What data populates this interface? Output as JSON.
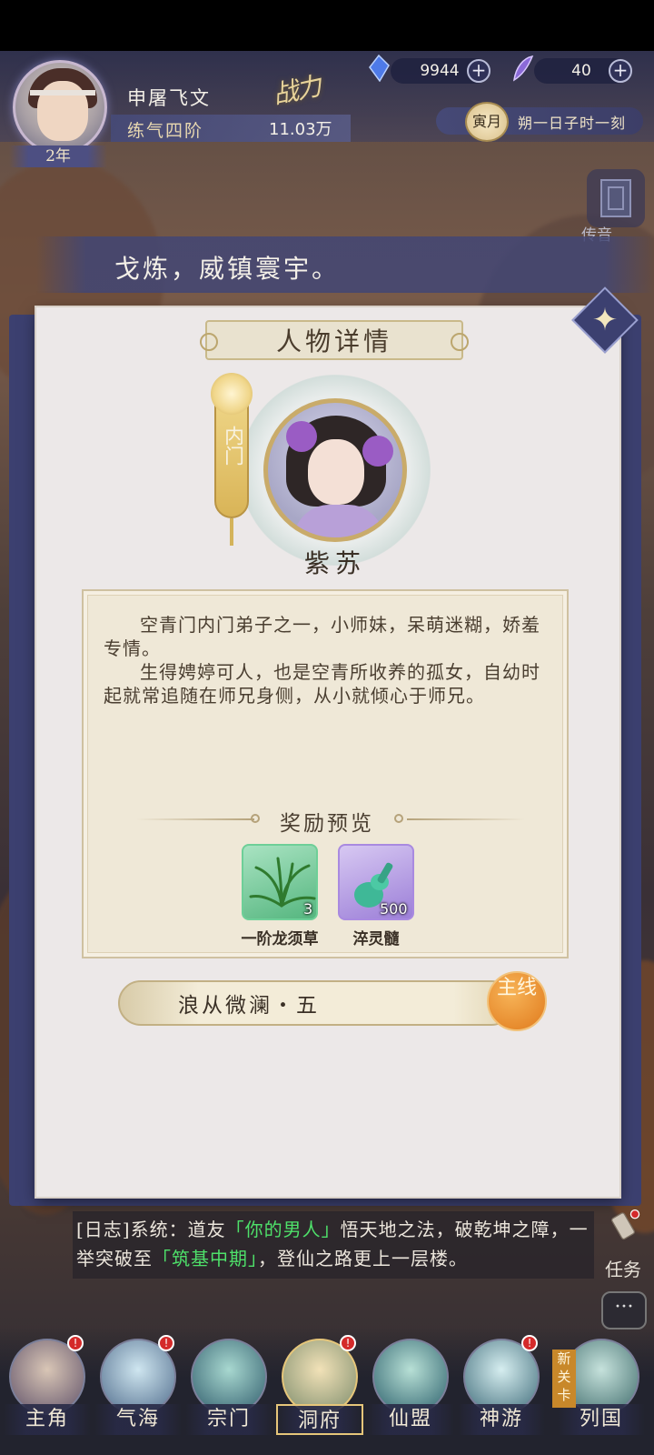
{
  "hud": {
    "player_name": "申屠飞文",
    "realm": "练气四阶",
    "age": "2年",
    "power_label": "战力",
    "power_value": "11.03万",
    "currency_crystal": "9944",
    "currency_feather": "40",
    "month": "寅月",
    "time": "朔一日子时一刻"
  },
  "side": {
    "transmit_label": "传音"
  },
  "marquee": {
    "text": "戈炼，威镇寰宇。"
  },
  "dialog": {
    "title": "人物详情",
    "sect": "内门",
    "character_name": "紫苏",
    "description": [
      "空青门内门弟子之一，小师妹，呆萌迷糊，娇羞专情。",
      "生得娉婷可人，也是空青所收养的孤女，自幼时起就常追随在师兄身侧，从小就倾心于师兄。"
    ],
    "reward_title": "奖励预览",
    "rewards": [
      {
        "name": "一阶龙须草",
        "count": "3",
        "icon": "herb-icon",
        "rarity_color": "#6ecf98"
      },
      {
        "name": "淬灵髓",
        "count": "500",
        "icon": "jade-gourd-icon",
        "rarity_color": "#a98ae0"
      }
    ],
    "quest_name": "浪从微澜・五",
    "quest_tag": "主线"
  },
  "log": {
    "prefix": "[日志]系统：道友",
    "name": "「你的男人」",
    "mid": "悟天地之法，破乾坤之障，一举突破至",
    "stage": "「筑基中期」",
    "suffix": "，登仙之路更上一层楼。"
  },
  "task_label": "任务",
  "nav": [
    {
      "label": "主角",
      "badge": "!"
    },
    {
      "label": "气海",
      "badge": "!"
    },
    {
      "label": "宗门",
      "badge": ""
    },
    {
      "label": "洞府",
      "badge": "!"
    },
    {
      "label": "仙盟",
      "badge": ""
    },
    {
      "label": "神游",
      "badge": "!"
    },
    {
      "label": "列国",
      "badge": ""
    }
  ],
  "new_stage_tag": "新关卡"
}
